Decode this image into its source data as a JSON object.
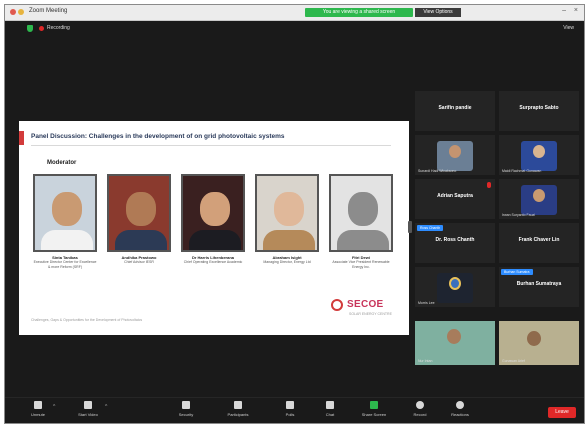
{
  "window": {
    "title": "Zoom Meeting",
    "share_bar": "You are viewing a shared screen",
    "view_options": "View Options"
  },
  "topbar": {
    "recording": "Recording",
    "view": "View"
  },
  "slide": {
    "title": "Panel Discussion: Challenges in the development of on grid photovoltaic systems",
    "moderator_label": "Moderator",
    "panelists": [
      {
        "name": "Sinta Tanibas",
        "role": "Executive Director Center for Excellence & more Reform (SRF)"
      },
      {
        "name": "Andhika Prastowo",
        "role": "Chief Advisor IESR"
      },
      {
        "name": "Dr Harris Lihenberana",
        "role": "Chief Operating Excellence Academic"
      },
      {
        "name": "Abraham Isight",
        "role": "Managing Director, Energy Ltd"
      },
      {
        "name": "Fitri Dewi",
        "role": "Associate Vice President Renewable Energy Inc."
      }
    ],
    "footer": "Challenges, Gaps & Opportunities for the Development of Photovoltaics",
    "logo": "SECOE",
    "logo_sub": "SOLAR ENERGY CENTRE"
  },
  "gallery": {
    "tiles": [
      {
        "name": "Sarifin pandie",
        "foot": "",
        "badge": ""
      },
      {
        "name": "Surprapto Sabto",
        "foot": "",
        "badge": ""
      },
      {
        "name": "",
        "foot": "Sunardi Hadi Wicaksono",
        "badge": ""
      },
      {
        "name": "",
        "foot": "Maidi Rachmat Gunawan",
        "badge": ""
      },
      {
        "name": "Adrian Saputra",
        "foot": "",
        "badge": ""
      },
      {
        "name": "",
        "foot": "Irwan Suryanto Fauzi",
        "badge": ""
      },
      {
        "name": "Dr. Ross Chanth",
        "foot": "",
        "badge": "Ross Chanth"
      },
      {
        "name": "Frank Chaver Lin",
        "foot": "",
        "badge": ""
      },
      {
        "name": "",
        "foot": "Morris Lee",
        "badge": ""
      },
      {
        "name": "Burhan Sumatraya",
        "foot": "",
        "badge": "Burhan Sumatra"
      },
      {
        "name": "",
        "foot": "Nur Intan",
        "badge": ""
      },
      {
        "name": "",
        "foot": "Gunawan Arief",
        "badge": ""
      }
    ]
  },
  "toolbar": {
    "items": [
      "Unmute",
      "Start Video",
      "Security",
      "Participants",
      "Polls",
      "Chat",
      "Share Screen",
      "Record",
      "Reactions"
    ],
    "end": "Leave"
  },
  "colors": {
    "accent_red": "#e02828",
    "zoom_blue": "#2d8cff",
    "share_green": "#2db84d",
    "slide_title": "#2a3a5a",
    "secoe": "#c8345a"
  }
}
